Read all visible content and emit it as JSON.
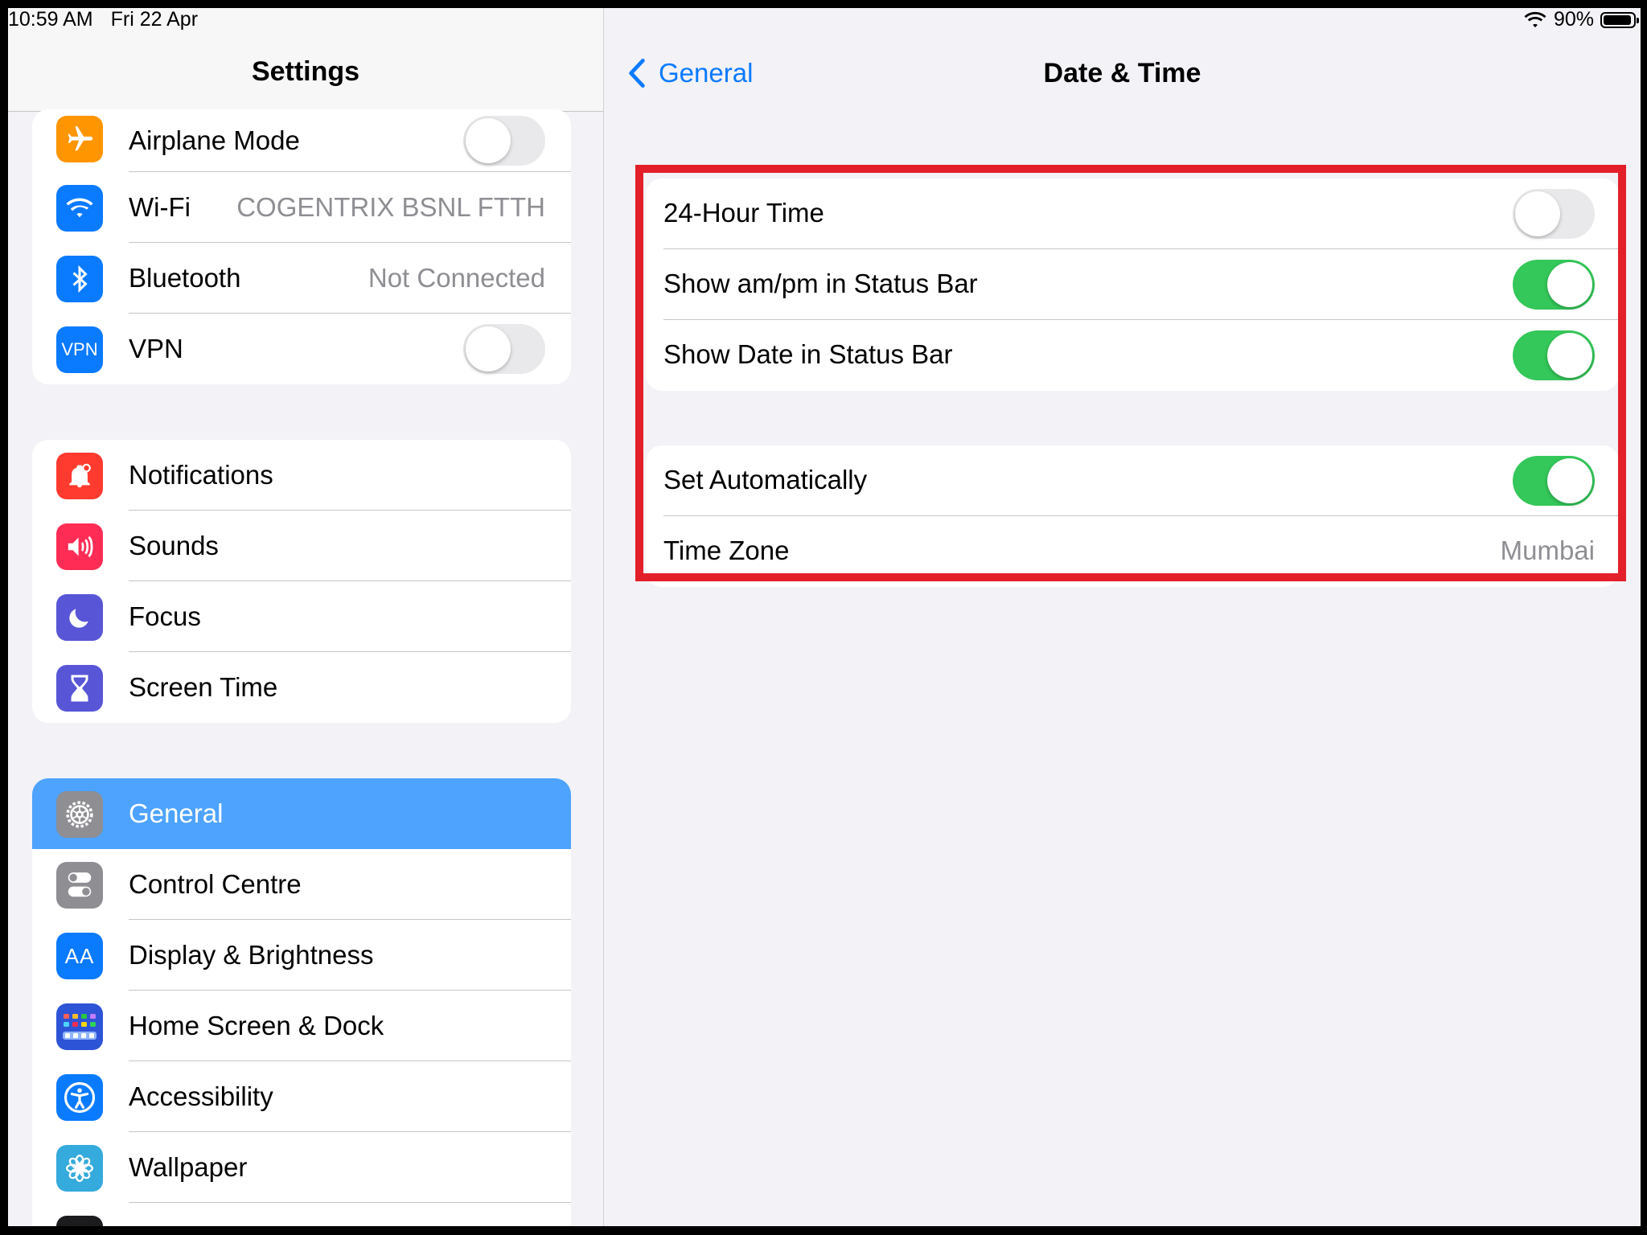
{
  "status_bar": {
    "time": "10:59 AM",
    "date": "Fri 22 Apr",
    "battery": "90%"
  },
  "sidebar": {
    "title": "Settings",
    "group1": [
      {
        "label": "Airplane Mode",
        "icon": "airplane-icon",
        "color": "#ff9500",
        "toggle": false
      },
      {
        "label": "Wi-Fi",
        "icon": "wifi-icon",
        "color": "#0a7aff",
        "value": "COGENTRIX BSNL FTTH"
      },
      {
        "label": "Bluetooth",
        "icon": "bluetooth-icon",
        "color": "#0a7aff",
        "value": "Not Connected"
      },
      {
        "label": "VPN",
        "icon": "vpn-icon",
        "icon_text": "VPN",
        "color": "#0a7aff",
        "toggle": false
      }
    ],
    "group2": [
      {
        "label": "Notifications",
        "icon": "bell-icon",
        "color": "#ff3b30"
      },
      {
        "label": "Sounds",
        "icon": "speaker-icon",
        "color": "#ff2d55"
      },
      {
        "label": "Focus",
        "icon": "moon-icon",
        "color": "#5856d6"
      },
      {
        "label": "Screen Time",
        "icon": "hourglass-icon",
        "color": "#5856d6"
      }
    ],
    "group3": [
      {
        "label": "General",
        "icon": "gear-icon",
        "color": "#8e8e93",
        "selected": true
      },
      {
        "label": "Control Centre",
        "icon": "switches-icon",
        "color": "#8e8e93"
      },
      {
        "label": "Display & Brightness",
        "icon": "text-size-icon",
        "icon_text": "AA",
        "color": "#0a7aff"
      },
      {
        "label": "Home Screen & Dock",
        "icon": "app-grid-icon",
        "color": "#2d54d6"
      },
      {
        "label": "Accessibility",
        "icon": "accessibility-icon",
        "color": "#0a7aff"
      },
      {
        "label": "Wallpaper",
        "icon": "flower-icon",
        "color": "#35aadc"
      }
    ]
  },
  "detail": {
    "back_label": "General",
    "title": "Date & Time",
    "group1": [
      {
        "label": "24-Hour Time",
        "toggle": false
      },
      {
        "label": "Show am/pm in Status Bar",
        "toggle": true
      },
      {
        "label": "Show Date in Status Bar",
        "toggle": true
      }
    ],
    "group2": [
      {
        "label": "Set Automatically",
        "toggle": true
      },
      {
        "label": "Time Zone",
        "value": "Mumbai"
      }
    ]
  },
  "colors": {
    "accent": "#0a7aff",
    "toggle_on": "#34c759",
    "selected_row": "#4da3ff",
    "highlight": "#e3202a"
  }
}
